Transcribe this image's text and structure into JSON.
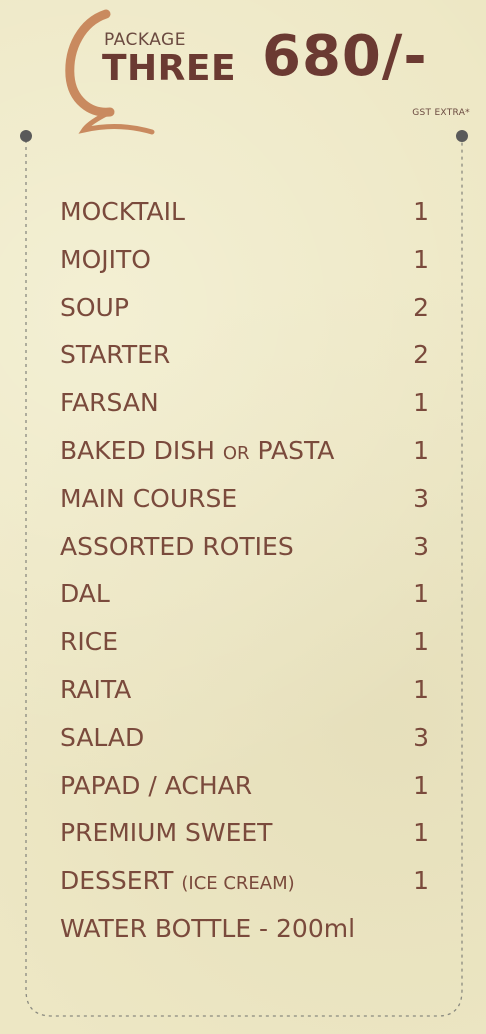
{
  "header": {
    "package_label": "PACKAGE",
    "package_name": "THREE",
    "price": "680/-",
    "tax_note": "GST EXTRA*"
  },
  "colors": {
    "background": "#ede7c4",
    "text": "#7a4a3c",
    "heading": "#6b3a32",
    "logo": "#c98a5f",
    "dots": "#5a5a5a"
  },
  "items": [
    {
      "name": "MOCKTAIL",
      "qty": "1"
    },
    {
      "name": "MOJITO",
      "qty": "1"
    },
    {
      "name": "SOUP",
      "qty": "2"
    },
    {
      "name": "STARTER",
      "qty": "2"
    },
    {
      "name": "FARSAN",
      "qty": "1"
    },
    {
      "name_a": "BAKED DISH ",
      "name_b": "OR",
      "name_c": " PASTA",
      "qty": "1"
    },
    {
      "name": "MAIN COURSE",
      "qty": "3"
    },
    {
      "name": "ASSORTED ROTIES",
      "qty": "3"
    },
    {
      "name": "DAL",
      "qty": "1"
    },
    {
      "name": "RICE",
      "qty": "1"
    },
    {
      "name": "RAITA",
      "qty": "1"
    },
    {
      "name": "SALAD",
      "qty": "3"
    },
    {
      "name": "PAPAD / ACHAR",
      "qty": "1"
    },
    {
      "name": "PREMIUM SWEET",
      "qty": "1"
    },
    {
      "name_a": "DESSERT ",
      "name_b": "(ICE CREAM)",
      "qty": "1"
    },
    {
      "name": "WATER BOTTLE - 200ml",
      "qty": ""
    }
  ]
}
